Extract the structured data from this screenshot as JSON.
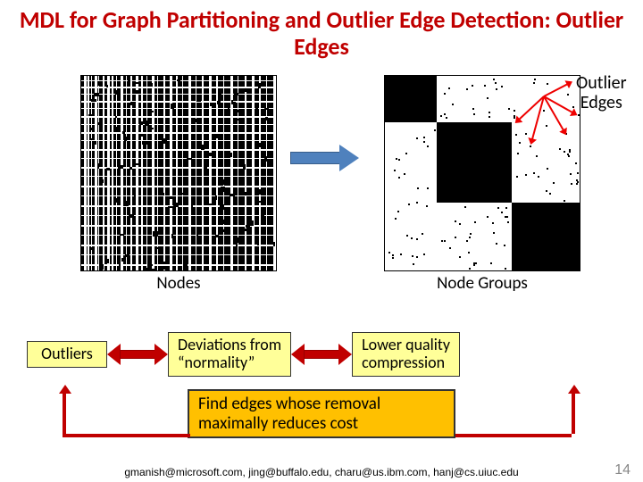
{
  "title": "MDL for Graph Partitioning and Outlier Edge Detection: Outlier Edges",
  "left": {
    "yaxis": "Nodes",
    "xaxis": "Nodes"
  },
  "right": {
    "yaxis": "Node Groups",
    "xaxis": "Node Groups"
  },
  "outlier_edges_label_l1": "Outlier",
  "outlier_edges_label_l2": "Edges",
  "box_outliers": "Outliers",
  "box_deviations_l1": "Deviations from",
  "box_deviations_l2": "“normality”",
  "box_lowerq_l1": "Lower quality",
  "box_lowerq_l2": "compression",
  "find_box_l1": "Find edges whose removal",
  "find_box_l2": "maximally reduces cost",
  "footer_emails": "gmanish@microsoft.com, jing@buffalo.edu, charu@us.ibm.com, hanj@cs.uiuc.edu",
  "page_number": "14"
}
